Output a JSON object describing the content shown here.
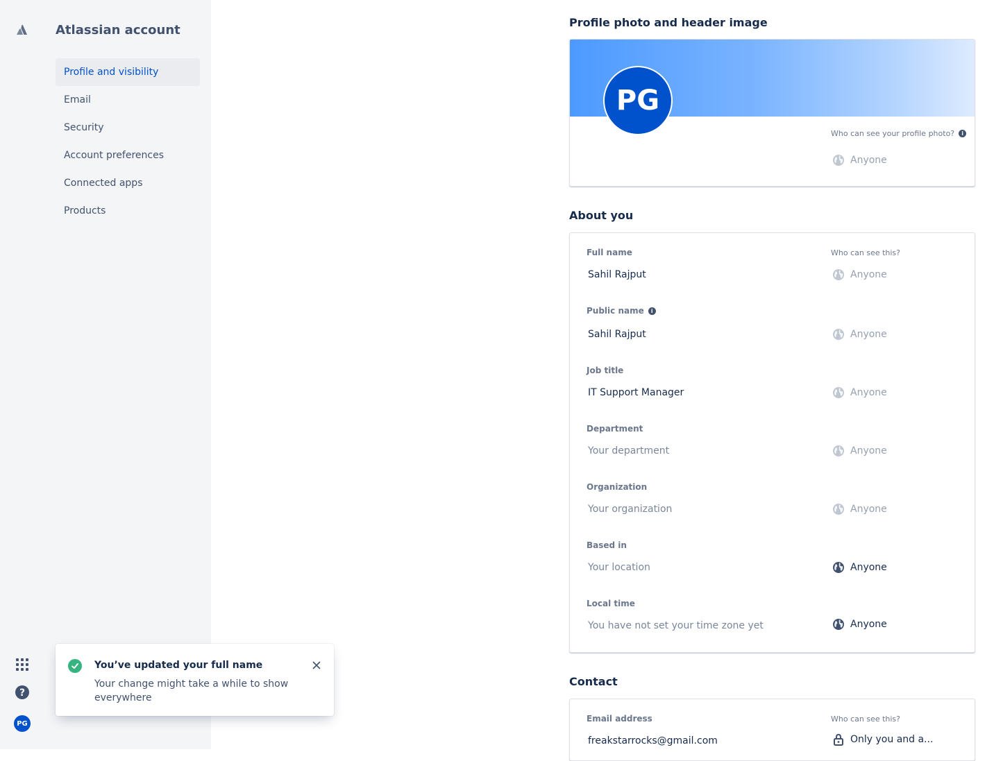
{
  "app": {
    "title": "Atlassian account",
    "avatar_initials": "PG"
  },
  "rail": {
    "logo_icon": "atlassian-logo-icon",
    "apps_icon": "app-switcher-icon",
    "help_icon": "help-icon"
  },
  "sidebar": {
    "items": [
      {
        "label": "Profile and visibility",
        "active": true
      },
      {
        "label": "Email"
      },
      {
        "label": "Security"
      },
      {
        "label": "Account preferences"
      },
      {
        "label": "Connected apps"
      },
      {
        "label": "Products"
      }
    ]
  },
  "profile_photo": {
    "section_title": "Profile photo and header image",
    "initials": "PG",
    "who_label": "Who can see your profile photo?",
    "visibility": "Anyone"
  },
  "about": {
    "section_title": "About you",
    "who_label": "Who can see this?",
    "fields": [
      {
        "label": "Full name",
        "value": "Sahil Rajput",
        "visibility": "Anyone"
      },
      {
        "label": "Public name",
        "value": "Sahil Rajput",
        "visibility": "Anyone"
      },
      {
        "label": "Job title",
        "value": "IT Support Manager",
        "visibility": "Anyone"
      },
      {
        "label": "Department",
        "placeholder": "Your department",
        "visibility": "Anyone"
      },
      {
        "label": "Organization",
        "placeholder": "Your organization",
        "visibility": "Anyone"
      },
      {
        "label": "Based in",
        "placeholder": "Your location",
        "visibility": "Anyone"
      },
      {
        "label": "Local time",
        "placeholder": "You have not set your time zone yet",
        "visibility": "Anyone"
      }
    ]
  },
  "contact": {
    "section_title": "Contact",
    "email_label": "Email address",
    "who_label": "Who can see this?",
    "email_value": "freakstarrocks@gmail.com",
    "visibility": "Only you and a..."
  },
  "toast": {
    "title": "You’ve updated your full name",
    "body": "Your change might take a while to show everywhere"
  },
  "colors": {
    "brand": "#0052cc",
    "success": "#36b37e",
    "sidebar_bg": "#f4f5f7"
  }
}
